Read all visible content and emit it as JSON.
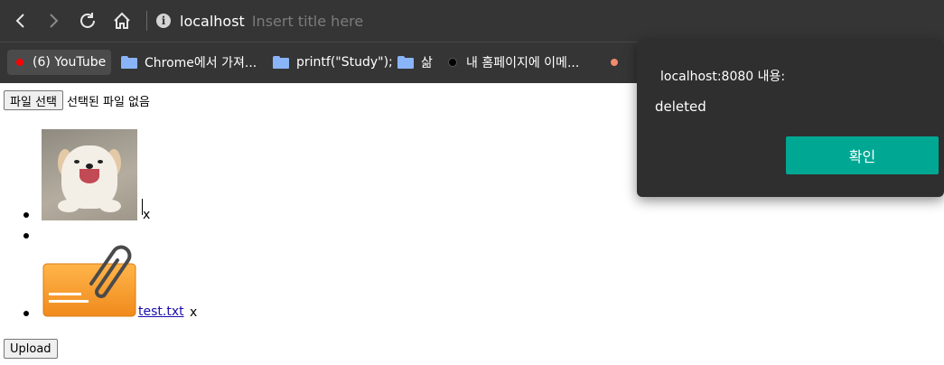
{
  "browser": {
    "address_host": "localhost",
    "address_title_placeholder": "Insert title here",
    "bookmarks": [
      {
        "label": "(6) YouTube",
        "icon": "youtube-dot",
        "color": "#ff0000"
      },
      {
        "label": "Chrome에서 가져...",
        "icon": "folder-icon"
      },
      {
        "label": "printf(\"Study\");",
        "icon": "folder-icon"
      },
      {
        "label": "삶",
        "icon": "folder-icon"
      },
      {
        "label": "내 홈페이지에 이메...",
        "icon": "black-dot",
        "color": "#000000"
      },
      {
        "label": "",
        "icon": "orange-dot",
        "color": "#f28b6e"
      }
    ]
  },
  "page": {
    "file_input": {
      "button_label": "파일 선택",
      "status": "선택된 파일 없음"
    },
    "files": [
      {
        "type": "image",
        "remove_label": "x"
      },
      {
        "type": "empty"
      },
      {
        "type": "attachment",
        "link_text": "test.txt",
        "remove_label": "x"
      }
    ],
    "upload_label": "Upload"
  },
  "alert": {
    "title": "localhost:8080 내용:",
    "message": "deleted",
    "ok_label": "확인",
    "ok_color": "#00a894"
  }
}
